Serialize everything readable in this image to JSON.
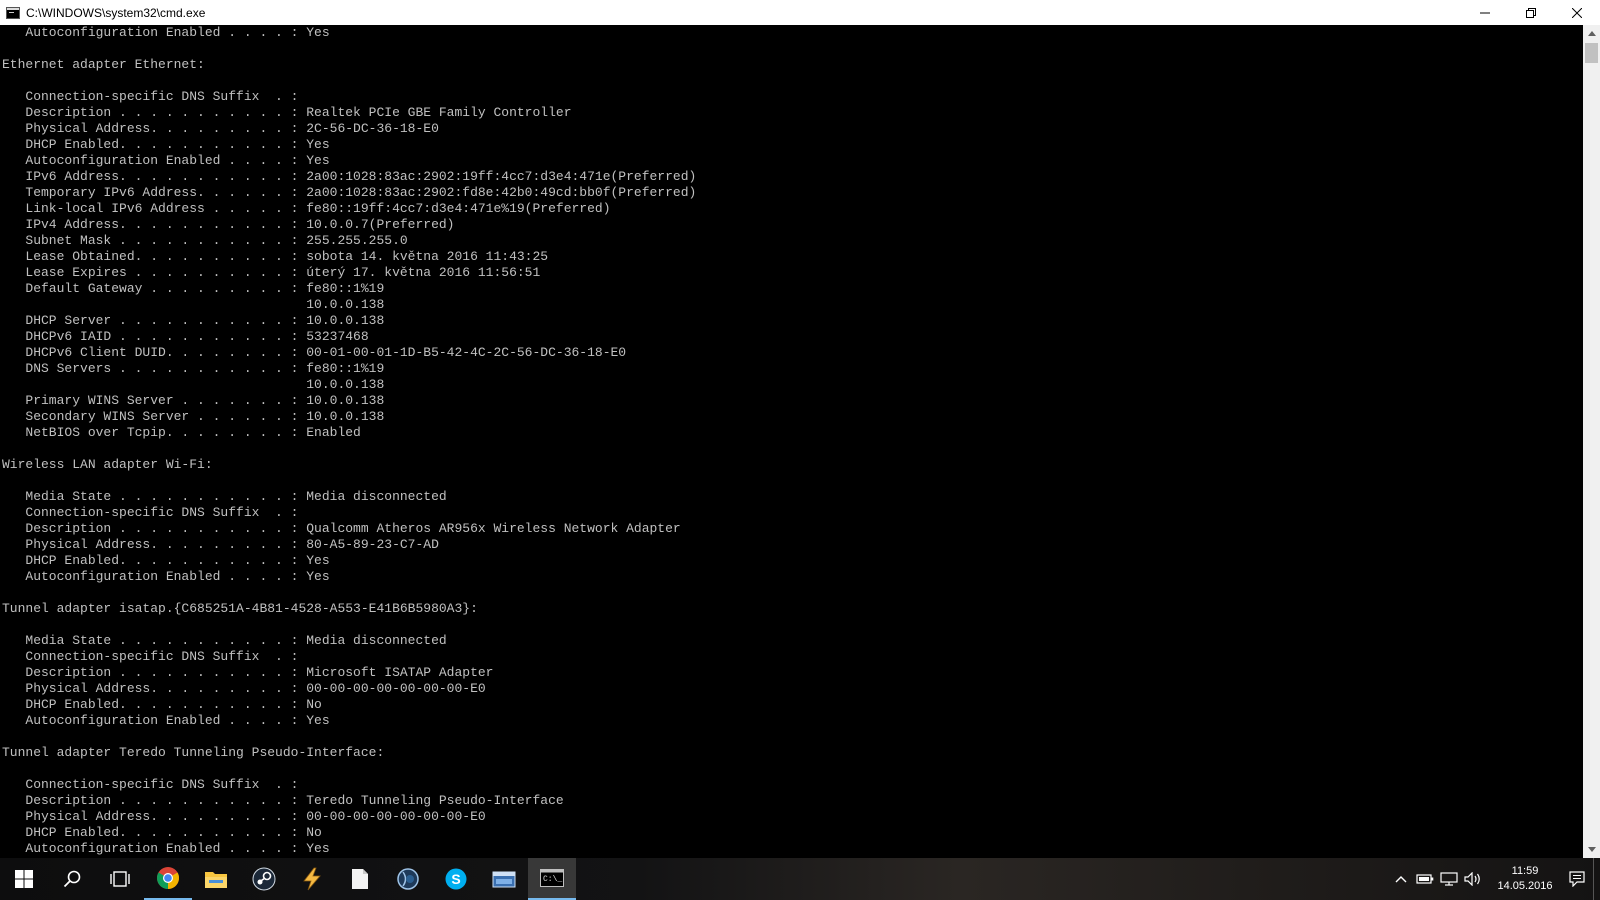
{
  "window": {
    "title": "C:\\WINDOWS\\system32\\cmd.exe",
    "minimize_label": "Minimize",
    "restore_label": "Restore Down",
    "close_label": "Close"
  },
  "console": {
    "lines": [
      "   Autoconfiguration Enabled . . . . : Yes",
      "",
      "Ethernet adapter Ethernet:",
      "",
      "   Connection-specific DNS Suffix  . :",
      "   Description . . . . . . . . . . . : Realtek PCIe GBE Family Controller",
      "   Physical Address. . . . . . . . . : 2C-56-DC-36-18-E0",
      "   DHCP Enabled. . . . . . . . . . . : Yes",
      "   Autoconfiguration Enabled . . . . : Yes",
      "   IPv6 Address. . . . . . . . . . . : 2a00:1028:83ac:2902:19ff:4cc7:d3e4:471e(Preferred)",
      "   Temporary IPv6 Address. . . . . . : 2a00:1028:83ac:2902:fd8e:42b0:49cd:bb0f(Preferred)",
      "   Link-local IPv6 Address . . . . . : fe80::19ff:4cc7:d3e4:471e%19(Preferred)",
      "   IPv4 Address. . . . . . . . . . . : 10.0.0.7(Preferred)",
      "   Subnet Mask . . . . . . . . . . . : 255.255.255.0",
      "   Lease Obtained. . . . . . . . . . : sobota 14. května 2016 11:43:25",
      "   Lease Expires . . . . . . . . . . : úterý 17. května 2016 11:56:51",
      "   Default Gateway . . . . . . . . . : fe80::1%19",
      "                                       10.0.0.138",
      "   DHCP Server . . . . . . . . . . . : 10.0.0.138",
      "   DHCPv6 IAID . . . . . . . . . . . : 53237468",
      "   DHCPv6 Client DUID. . . . . . . . : 00-01-00-01-1D-B5-42-4C-2C-56-DC-36-18-E0",
      "   DNS Servers . . . . . . . . . . . : fe80::1%19",
      "                                       10.0.0.138",
      "   Primary WINS Server . . . . . . . : 10.0.0.138",
      "   Secondary WINS Server . . . . . . : 10.0.0.138",
      "   NetBIOS over Tcpip. . . . . . . . : Enabled",
      "",
      "Wireless LAN adapter Wi-Fi:",
      "",
      "   Media State . . . . . . . . . . . : Media disconnected",
      "   Connection-specific DNS Suffix  . :",
      "   Description . . . . . . . . . . . : Qualcomm Atheros AR956x Wireless Network Adapter",
      "   Physical Address. . . . . . . . . : 80-A5-89-23-C7-AD",
      "   DHCP Enabled. . . . . . . . . . . : Yes",
      "   Autoconfiguration Enabled . . . . : Yes",
      "",
      "Tunnel adapter isatap.{C685251A-4B81-4528-A553-E41B6B5980A3}:",
      "",
      "   Media State . . . . . . . . . . . : Media disconnected",
      "   Connection-specific DNS Suffix  . :",
      "   Description . . . . . . . . . . . : Microsoft ISATAP Adapter",
      "   Physical Address. . . . . . . . . : 00-00-00-00-00-00-00-E0",
      "   DHCP Enabled. . . . . . . . . . . : No",
      "   Autoconfiguration Enabled . . . . : Yes",
      "",
      "Tunnel adapter Teredo Tunneling Pseudo-Interface:",
      "",
      "   Connection-specific DNS Suffix  . :",
      "   Description . . . . . . . . . . . : Teredo Tunneling Pseudo-Interface",
      "   Physical Address. . . . . . . . . : 00-00-00-00-00-00-00-E0",
      "   DHCP Enabled. . . . . . . . . . . : No",
      "   Autoconfiguration Enabled . . . . : Yes"
    ]
  },
  "taskbar": {
    "apps": [
      {
        "name": "start-button",
        "icon": "windows-logo-icon",
        "state": "normal"
      },
      {
        "name": "search-button",
        "icon": "search-icon",
        "state": "normal"
      },
      {
        "name": "task-view-button",
        "icon": "task-view-icon",
        "state": "normal"
      },
      {
        "name": "taskbar-chrome",
        "icon": "chrome-icon",
        "state": "running"
      },
      {
        "name": "taskbar-file-explorer",
        "icon": "folder-icon",
        "state": "normal"
      },
      {
        "name": "taskbar-steam",
        "icon": "steam-icon",
        "state": "normal"
      },
      {
        "name": "taskbar-app-lightning",
        "icon": "lightning-icon",
        "state": "normal"
      },
      {
        "name": "taskbar-notepad",
        "icon": "document-icon",
        "state": "normal"
      },
      {
        "name": "taskbar-app-globe",
        "icon": "globe-icon",
        "state": "normal"
      },
      {
        "name": "taskbar-skype",
        "icon": "skype-icon",
        "state": "normal"
      },
      {
        "name": "taskbar-app-window",
        "icon": "window-app-icon",
        "state": "normal"
      },
      {
        "name": "taskbar-cmd",
        "icon": "cmd-icon",
        "state": "active"
      }
    ],
    "clock": {
      "time": "11:59",
      "date": "14.05.2016"
    }
  },
  "colors": {
    "console_text": "#c0c0c0",
    "console_bg": "#000000",
    "taskbar_accent": "#76b9ed",
    "chrome_red": "#db4437",
    "chrome_green": "#0f9d58",
    "chrome_yellow": "#f4b400",
    "chrome_blue": "#4285f4",
    "skype_blue": "#00aff0",
    "folder_yellow": "#f8c640"
  }
}
